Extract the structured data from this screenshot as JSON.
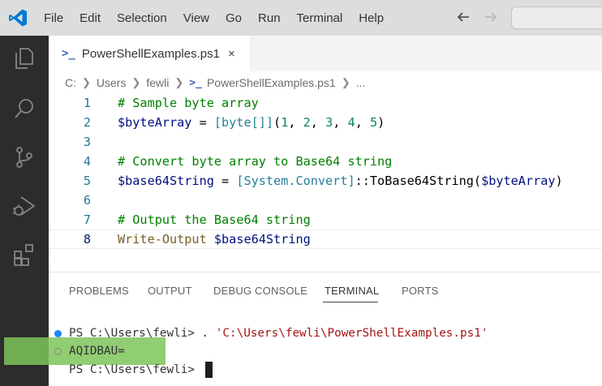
{
  "titlebar": {
    "menu": [
      "File",
      "Edit",
      "Selection",
      "View",
      "Go",
      "Run",
      "Terminal",
      "Help"
    ]
  },
  "colors": {
    "accent": "#0078d4",
    "activity_bar": "#2c2c2c",
    "terminal_highlight": "#7ec45a"
  },
  "activity_bar": {
    "icons": [
      "files-icon",
      "search-icon",
      "source-control-icon",
      "run-debug-icon",
      "extensions-icon"
    ]
  },
  "editor": {
    "tab": {
      "label": "PowerShellExamples.ps1",
      "icon": ">_",
      "close": "×"
    },
    "breadcrumb": [
      "C:",
      "Users",
      "fewli",
      "PowerShellExamples.ps1",
      "..."
    ],
    "lines": [
      {
        "num": "1",
        "tokens": [
          {
            "t": "# Sample byte array",
            "c": "comment"
          }
        ]
      },
      {
        "num": "2",
        "tokens": [
          {
            "t": "$byteArray",
            "c": "var"
          },
          {
            "t": " = ",
            "c": "op"
          },
          {
            "t": "[byte[]]",
            "c": "type"
          },
          {
            "t": "(",
            "c": "op"
          },
          {
            "t": "1",
            "c": "num"
          },
          {
            "t": ", ",
            "c": "op"
          },
          {
            "t": "2",
            "c": "num"
          },
          {
            "t": ", ",
            "c": "op"
          },
          {
            "t": "3",
            "c": "num"
          },
          {
            "t": ", ",
            "c": "op"
          },
          {
            "t": "4",
            "c": "num"
          },
          {
            "t": ", ",
            "c": "op"
          },
          {
            "t": "5",
            "c": "num"
          },
          {
            "t": ")",
            "c": "op"
          }
        ]
      },
      {
        "num": "3",
        "tokens": []
      },
      {
        "num": "4",
        "tokens": [
          {
            "t": "# Convert byte array to Base64 string",
            "c": "comment"
          }
        ]
      },
      {
        "num": "5",
        "tokens": [
          {
            "t": "$base64String",
            "c": "var"
          },
          {
            "t": " = ",
            "c": "op"
          },
          {
            "t": "[System.Convert]",
            "c": "type"
          },
          {
            "t": "::ToBase64String(",
            "c": "op"
          },
          {
            "t": "$byteArray",
            "c": "var"
          },
          {
            "t": ")",
            "c": "op"
          }
        ]
      },
      {
        "num": "6",
        "tokens": []
      },
      {
        "num": "7",
        "tokens": [
          {
            "t": "# Output the Base64 string",
            "c": "comment"
          }
        ]
      },
      {
        "num": "8",
        "tokens": [
          {
            "t": "Write-Output",
            "c": "func"
          },
          {
            "t": " ",
            "c": "op"
          },
          {
            "t": "$base64String",
            "c": "var"
          }
        ]
      }
    ],
    "current_line": "8"
  },
  "panel": {
    "tabs": [
      "PROBLEMS",
      "OUTPUT",
      "DEBUG CONSOLE",
      "TERMINAL",
      "PORTS"
    ],
    "active_tab": "TERMINAL",
    "terminal": {
      "line1_prompt": "PS C:\\Users\\fewli> . ",
      "line1_path": "'C:\\Users\\fewli\\PowerShellExamples.ps1'",
      "line2_output": "AQIDBAU=",
      "line3_prompt": "PS C:\\Users\\fewli> "
    }
  }
}
